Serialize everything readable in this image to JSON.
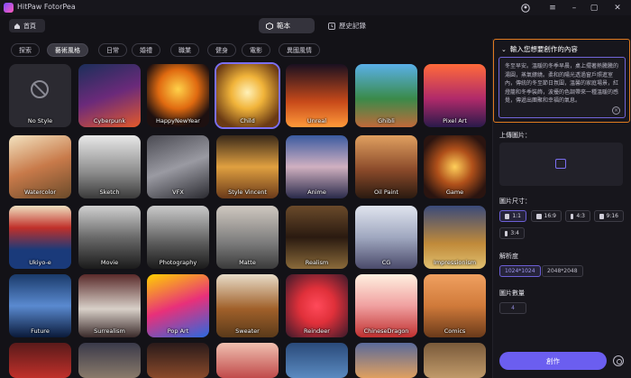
{
  "app": {
    "title": "HitPaw FotorPea"
  },
  "nav": {
    "home_label": "首頁",
    "tabs": [
      "範本",
      "歷史記錄"
    ]
  },
  "categories": [
    "探索",
    "藝術風格",
    "日常",
    "婚禮",
    "職業",
    "健身",
    "電影",
    "異國風情"
  ],
  "styles": [
    "No Style",
    "Cyberpunk",
    "HappyNewYear",
    "Child",
    "Unreal",
    "Ghibli",
    "Pixel Art",
    "Watercolor",
    "Sketch",
    "VFX",
    "Style Vincent",
    "Anime",
    "Oil Paint",
    "Game",
    "Ukiyo-e",
    "Movie",
    "Photography",
    "Matte",
    "Realism",
    "CG",
    "Impressionism",
    "Future",
    "Surrealism",
    "Pop Art",
    "Sweater",
    "Reindeer",
    "ChineseDragon",
    "Comics",
    "",
    "",
    "",
    "",
    "",
    "",
    ""
  ],
  "panel": {
    "prompt_title": "輸入您想要創作的內容",
    "prompt_text": "冬至早安。溫暖的冬季早晨，桌上擺著熱騰騰的湯圓，蒸氣繚繞。柔和的陽光透過窗戶照進室內，傳統的冬至節日氛圍，溫馨的家庭場景，紅燈籠和冬季裝飾，波擾的色調帶來一種溫暖的感覺，傳遞出團聚和幸福的氣息。",
    "upload_label": "上傳圖片：",
    "size_label": "圖片尺寸：",
    "ratios": [
      "1:1",
      "16:9",
      "4:3",
      "9:16",
      "3:4"
    ],
    "resolution_label": "解析度",
    "resolutions": [
      "1024*1024",
      "2048*2048"
    ],
    "count_label": "圖片數量",
    "count_value": "4",
    "create_label": "創作"
  }
}
